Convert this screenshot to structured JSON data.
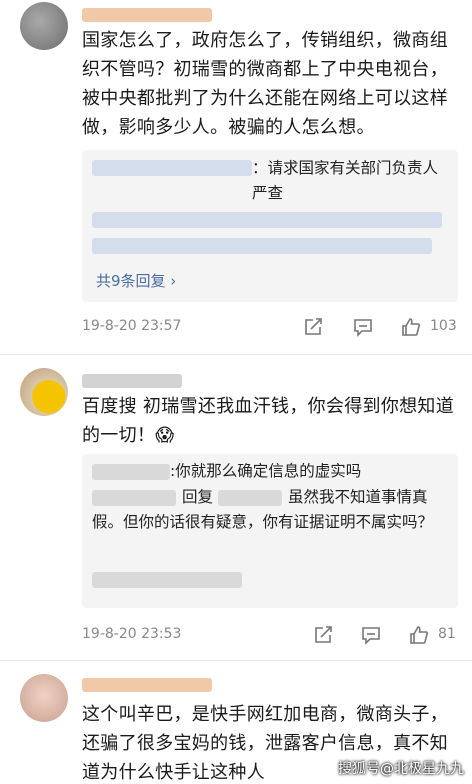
{
  "comments": [
    {
      "text": "国家怎么了，政府怎么了，传销组织，微商组织不管吗？初瑞雪的微商都上了中央电视台，被中央都批判了为什么还能在网络上可以这样做，影响多少人。被骗的人怎么想。",
      "reply_first": "：请求国家有关部门负责人严查",
      "more": "共9条回复 ›",
      "time": "19-8-20 23:57",
      "likes": "103"
    },
    {
      "text": "百度搜 初瑞雪还我血汗钱，你会得到你想知道的一切！😱",
      "reply1": ":你就那么确定信息的虚实吗",
      "reply2_prefix": "回复",
      "reply2_text": "虽然我不知道事情真假。但你的话很有疑意，你有证据证明不属实吗？",
      "time": "19-8-20 23:53",
      "likes": "81"
    },
    {
      "text": "这个叫辛巴，是快手网红加电商，微商头子，还骗了很多宝妈的钱，泄露客户信息，真不知道为什么快手让这种人"
    }
  ],
  "icons": [
    "share-icon",
    "comment-icon",
    "like-icon"
  ],
  "watermark": "搜狐号@北极星九九",
  "colors": {
    "link": "#4a6da0",
    "meta": "#888888",
    "reply_bg": "#f4f4f4"
  }
}
